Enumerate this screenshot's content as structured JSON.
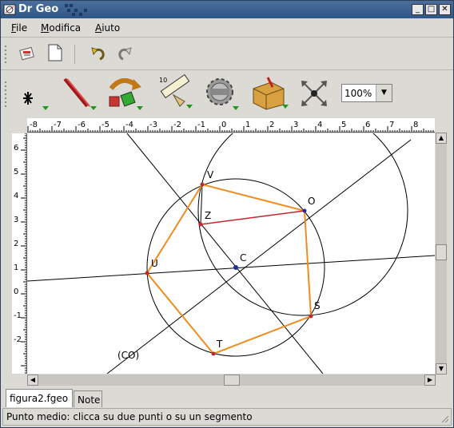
{
  "window": {
    "title": "Dr Geo",
    "buttons": [
      "_",
      "□",
      "✕"
    ]
  },
  "menubar": {
    "items": [
      {
        "label": "File",
        "mnemonic": "F",
        "rest": "ile"
      },
      {
        "label": "Modifica",
        "mnemonic": "M",
        "rest": "odifica"
      },
      {
        "label": "Aiuto",
        "mnemonic": "A",
        "rest": "iuto"
      }
    ]
  },
  "toolbar": {
    "zoom": "100%"
  },
  "ruler": {
    "top_ticks": [
      "-8",
      "-7",
      "-6",
      "-5",
      "-4",
      "-3",
      "-2",
      "-1",
      "0",
      "1",
      "2",
      "3",
      "4",
      "5",
      "6",
      "7",
      "8"
    ],
    "left_ticks": [
      "6",
      "5",
      "4",
      "3",
      "2",
      "1",
      "0",
      "-1",
      "-2"
    ]
  },
  "figure": {
    "labels": {
      "V": "V",
      "O": "O",
      "Z": "Z",
      "U": "U",
      "C": "C",
      "S": "S",
      "T": "T",
      "CO": "(CO)"
    }
  },
  "tabs": [
    {
      "label": "figura2.fgeo"
    },
    {
      "label": "Note"
    }
  ],
  "status": {
    "text": "Punto medio: clicca su due punti o su un segmento"
  },
  "colors": {
    "polygon": "#f08c1e",
    "segment": "#c0282d",
    "point": "#1e2fa0",
    "titlebar": "#3a6597"
  }
}
